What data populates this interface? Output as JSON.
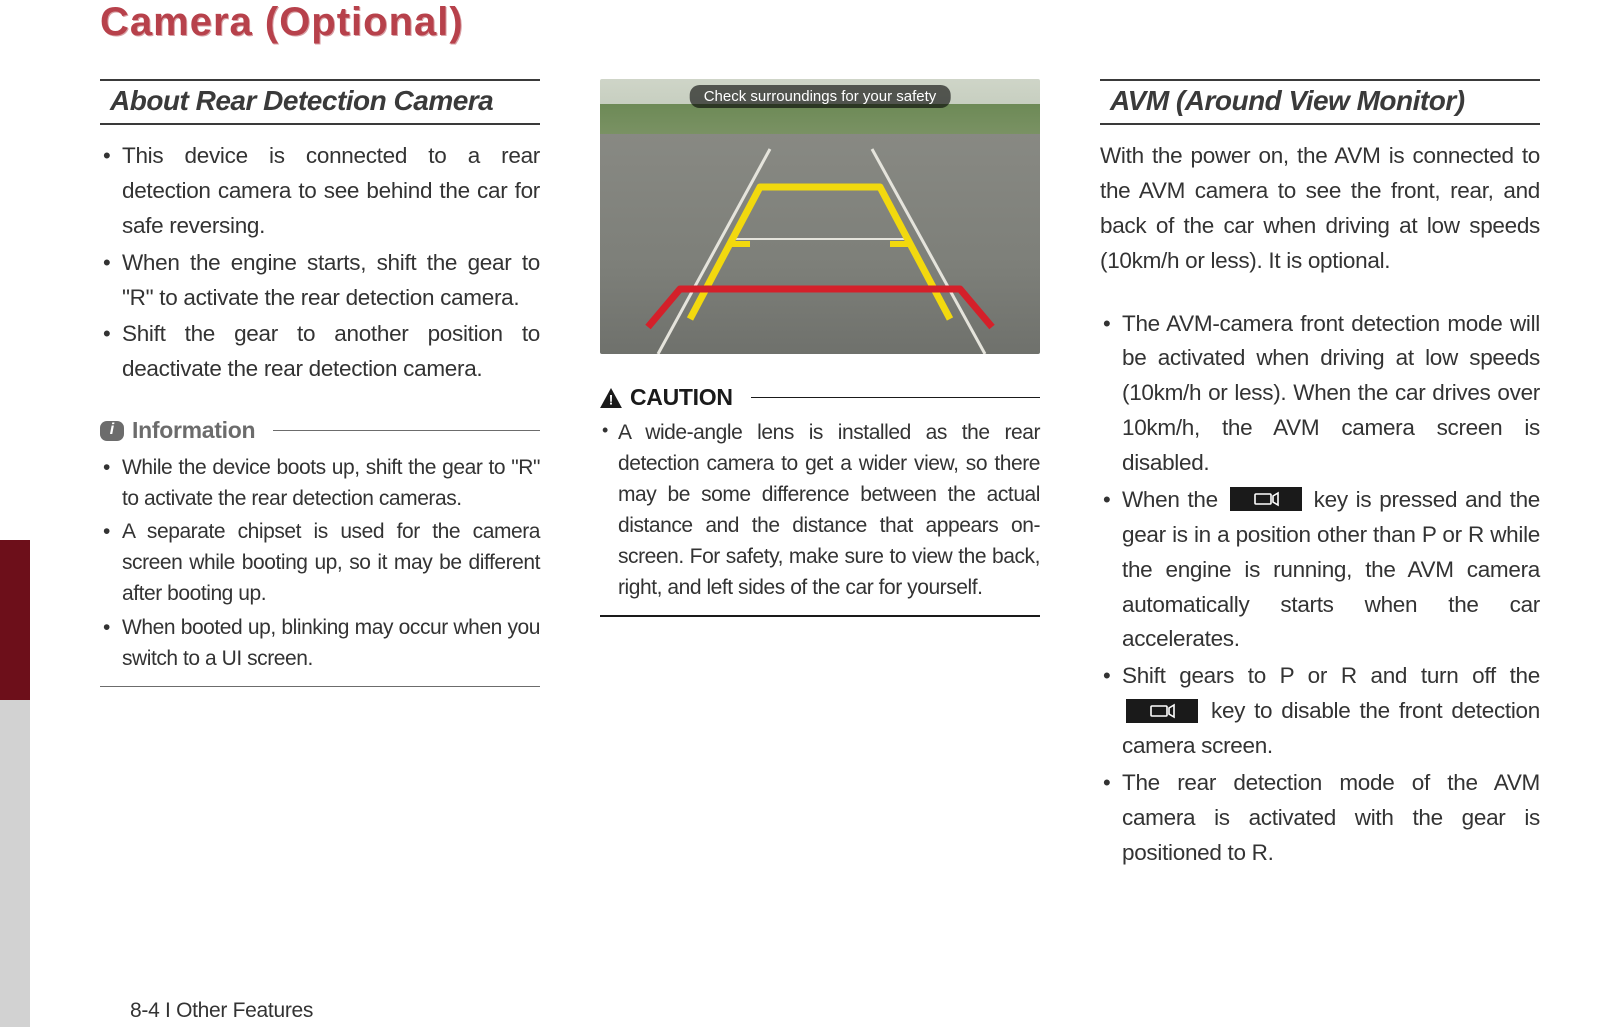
{
  "page_title": "Camera (Optional)",
  "footer": {
    "page_num": "8-4",
    "divider": " I ",
    "chapter": "Other Features"
  },
  "col1": {
    "section_head": "About Rear Detection Camera",
    "bullets": [
      "This device is connected to a rear detection camera to see behind the car for safe reversing.",
      "When the engine starts, shift the gear to \"R\" to activate the rear detection camera.",
      "Shift the gear to another position to deactivate the rear detection camera."
    ],
    "info_label": "Information",
    "info_bullets": [
      "While the device boots up, shift the gear to \"R\" to activate the rear detection cameras.",
      "A separate chipset is used for the camera screen while booting up, so it may be different after booting up.",
      "When booted up, blinking may occur when you switch to a UI screen."
    ]
  },
  "col2": {
    "camera_banner": "Check surroundings for your safety",
    "caution_label": "CAUTION",
    "caution_bullets": [
      "A wide-angle lens is installed as the rear detection camera to get a wider view, so there may be some difference between the actual distance and the distance that appears on-screen. For safety, make sure to view the back, right, and left sides of the car for yourself."
    ]
  },
  "col3": {
    "section_head": "AVM (Around View Monitor)",
    "intro": "With the power on, the AVM is connected to the AVM camera to see the front, rear, and back of the car when driving at low speeds (10km/h or less). It is optional.",
    "bullets_a": "The AVM-camera front detection mode will be activated when driving at low speeds (10km/h or less). When the car drives over 10km/h, the AVM camera screen is disabled.",
    "bullets_b_pre": "When the ",
    "bullets_b_post": " key is pressed and the gear is in a position other than P or R while the engine is running, the AVM camera automatically starts when the car accelerates.",
    "bullets_c_pre": "Shift gears to P or R and turn off the ",
    "bullets_c_post": " key to disable the front detection camera screen.",
    "bullets_d": "The rear detection mode of the AVM camera is activated with the gear is positioned to R."
  }
}
